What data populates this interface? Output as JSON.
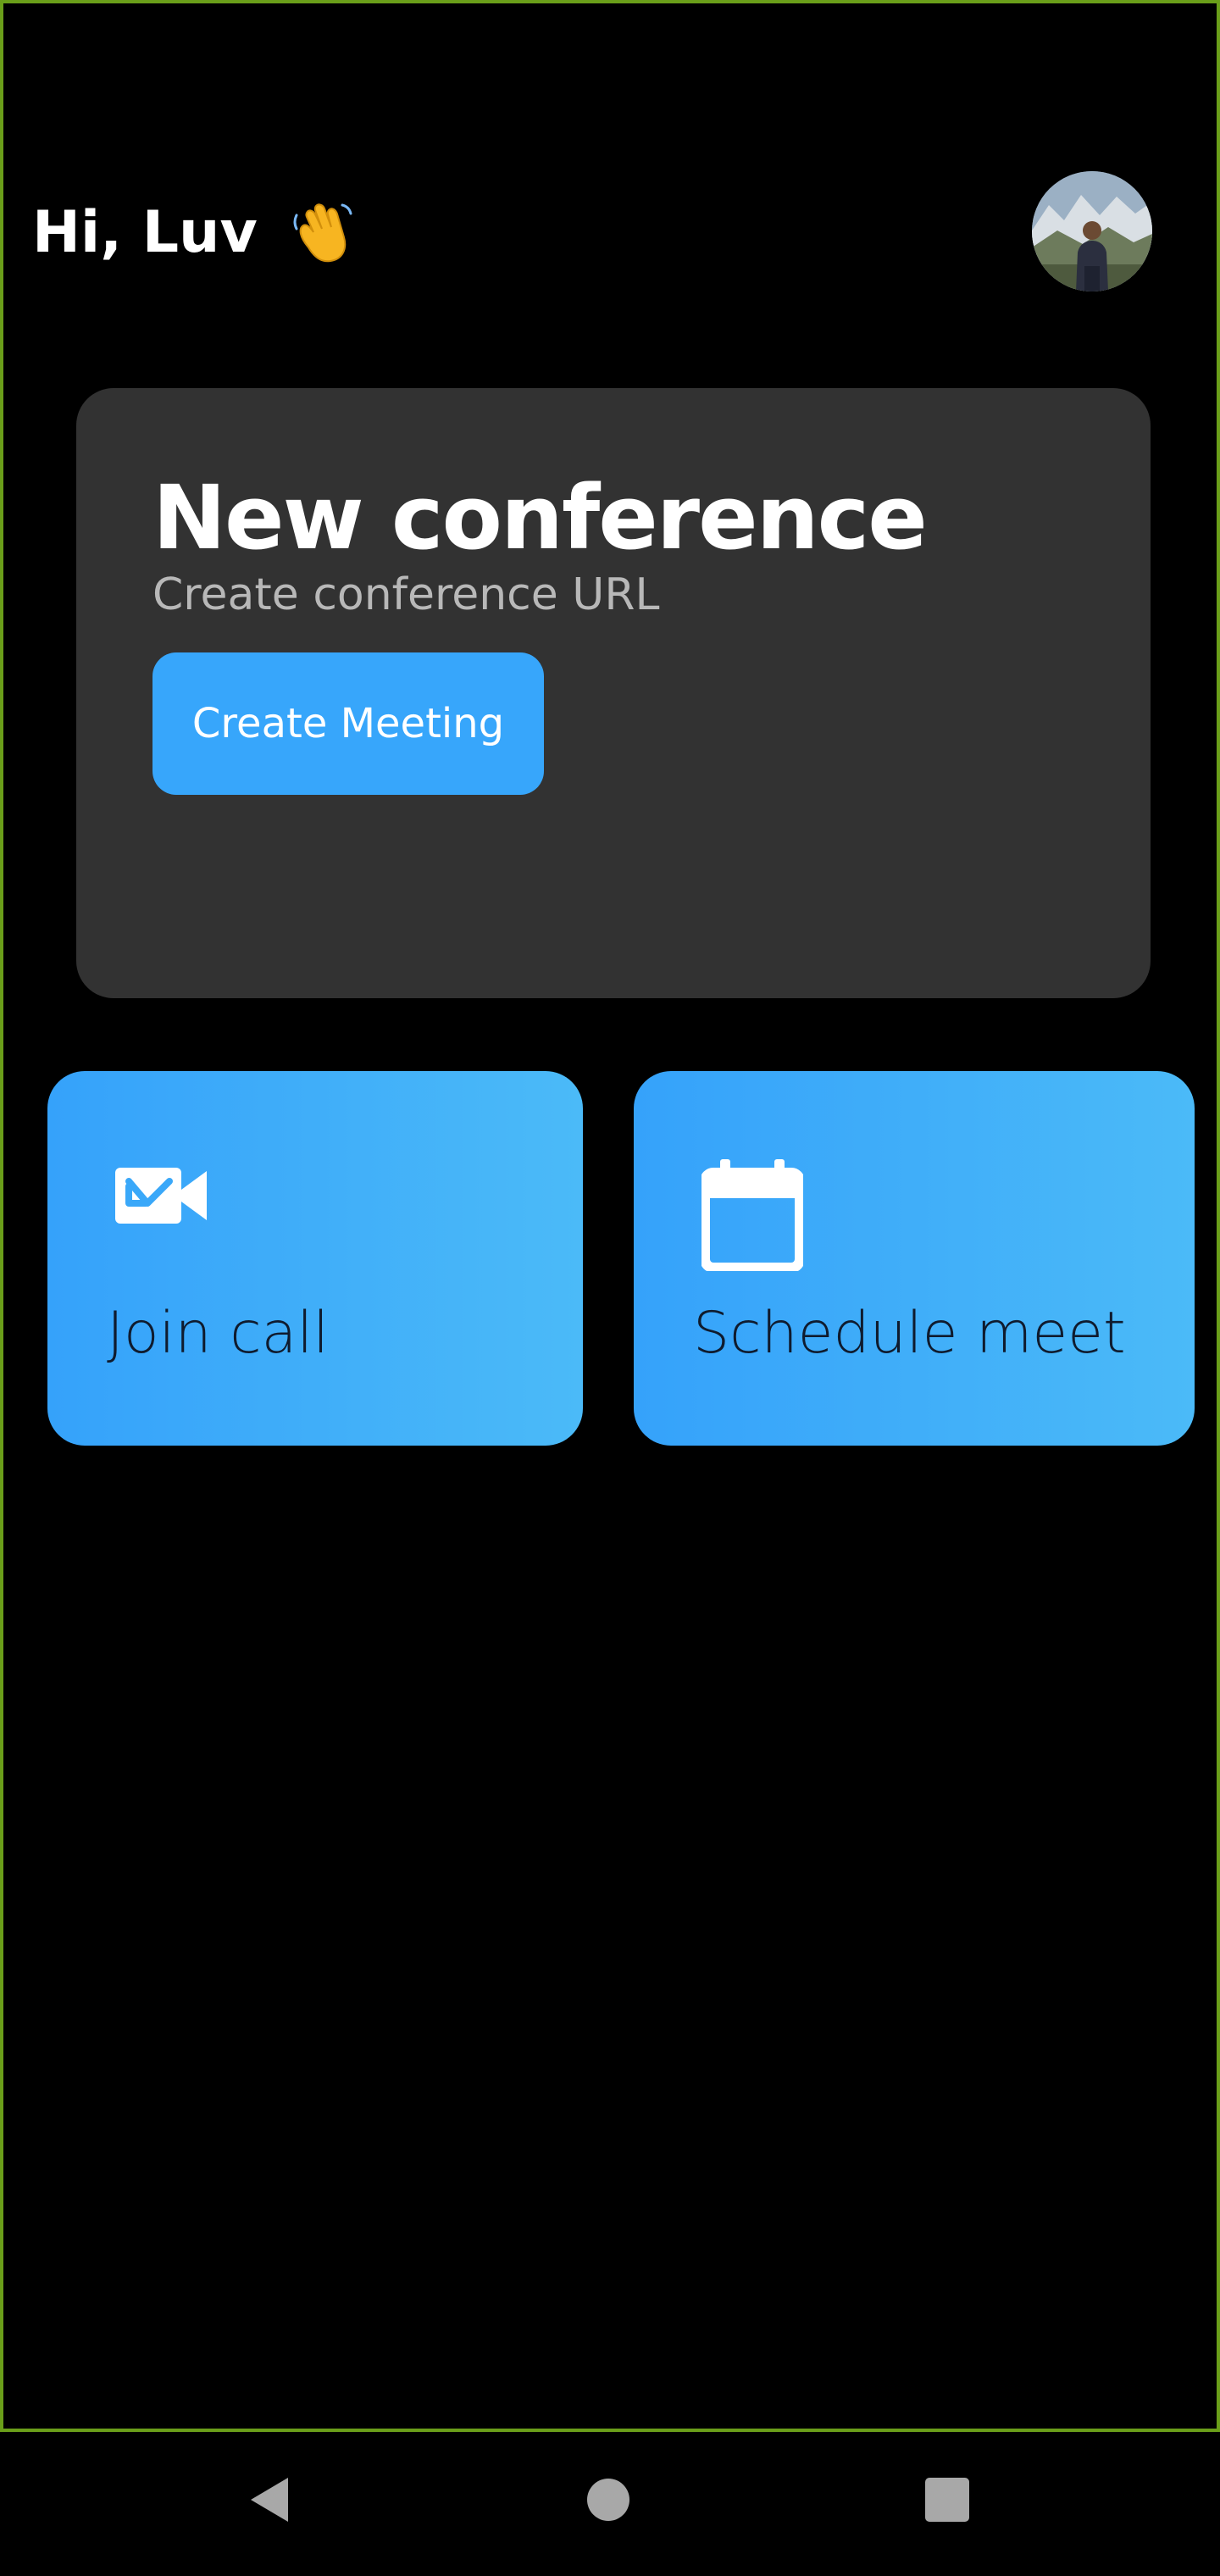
{
  "header": {
    "greeting": "Hi, Luv",
    "greeting_icon": "waving-hand-icon",
    "avatar_icon": "user-avatar"
  },
  "conference_card": {
    "title": "New conference",
    "subtitle": "Create conference URL",
    "create_button_label": "Create Meeting"
  },
  "tiles": [
    {
      "label": "Join call",
      "icon": "video-call-icon"
    },
    {
      "label": "Schedule meet",
      "icon": "calendar-icon"
    }
  ],
  "nav_bar": {
    "items": [
      "back-icon",
      "home-icon",
      "recents-icon"
    ]
  },
  "colors": {
    "background": "#000000",
    "card": "#323232",
    "accent": "#37a6fb",
    "tile_gradient_start": "#35a2fa",
    "tile_gradient_end": "#4bbaf8",
    "frame_border": "#6a9e1a"
  }
}
